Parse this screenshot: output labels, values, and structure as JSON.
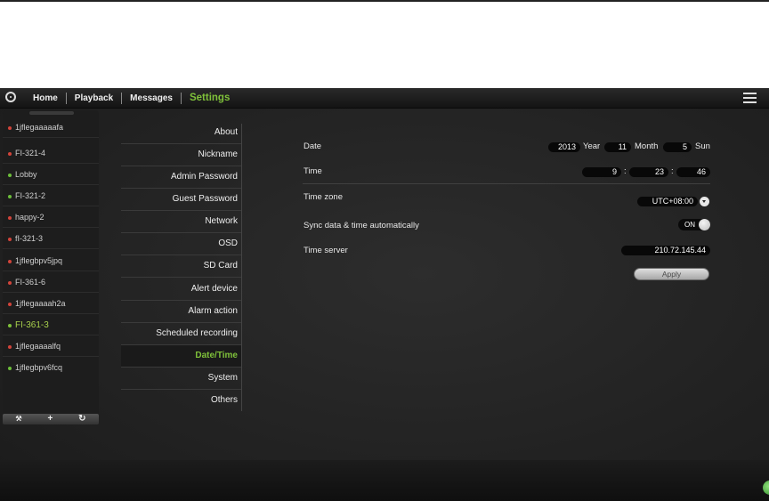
{
  "nav": {
    "items": [
      {
        "label": "Home"
      },
      {
        "label": "Playback"
      },
      {
        "label": "Messages"
      },
      {
        "label": "Settings"
      }
    ]
  },
  "devices": [
    {
      "name": "1jflegaaaaafa",
      "status_color": "#d2443a"
    },
    {
      "name": "FI-321-4",
      "status_color": "#d2443a"
    },
    {
      "name": "Lobby",
      "status_color": "#6cbf3a"
    },
    {
      "name": "FI-321-2",
      "status_color": "#6cbf3a"
    },
    {
      "name": "happy-2",
      "status_color": "#d2443a"
    },
    {
      "name": "fI-321-3",
      "status_color": "#d2443a"
    },
    {
      "name": "1jflegbpv5jpq",
      "status_color": "#d2443a"
    },
    {
      "name": "FI-361-6",
      "status_color": "#d2443a"
    },
    {
      "name": "1jflegaaaah2a",
      "status_color": "#d2443a"
    },
    {
      "name": "FI-361-3",
      "status_color": "#7fc13a"
    },
    {
      "name": "1jflegaaaalfq",
      "status_color": "#d2443a"
    },
    {
      "name": "1jflegbpv6fcq",
      "status_color": "#6cbf3a"
    }
  ],
  "device_tools": {
    "wrench": "🔧",
    "add": "+",
    "refresh": "↻"
  },
  "settings_menu": [
    {
      "label": "About"
    },
    {
      "label": "Nickname"
    },
    {
      "label": "Admin Password"
    },
    {
      "label": "Guest Password"
    },
    {
      "label": "Network"
    },
    {
      "label": "OSD"
    },
    {
      "label": "SD Card"
    },
    {
      "label": "Alert device"
    },
    {
      "label": "Alarm action"
    },
    {
      "label": "Scheduled recording"
    },
    {
      "label": "Date/Time"
    },
    {
      "label": "System"
    },
    {
      "label": "Others"
    }
  ],
  "datetime": {
    "date_label": "Date",
    "year": "2013",
    "year_unit": "Year",
    "month": "11",
    "month_unit": "Month",
    "day": "5",
    "weekday": "Sun",
    "time_label": "Time",
    "hour": "9",
    "minute": "23",
    "second": "46",
    "colon": ":",
    "timezone_label": "Time zone",
    "timezone": "UTC+08:00",
    "sync_label": "Sync data & time automatically",
    "sync_state": "ON",
    "server_label": "Time server",
    "server": "210.72.145.44",
    "apply_label": "Apply"
  },
  "colors": {
    "accent": "#7fc13a",
    "background": "#232323"
  },
  "icons": {
    "logo": "camera-logo-icon",
    "menu": "hamburger-menu-icon",
    "dropdown": "dropdown-arrow-icon"
  }
}
